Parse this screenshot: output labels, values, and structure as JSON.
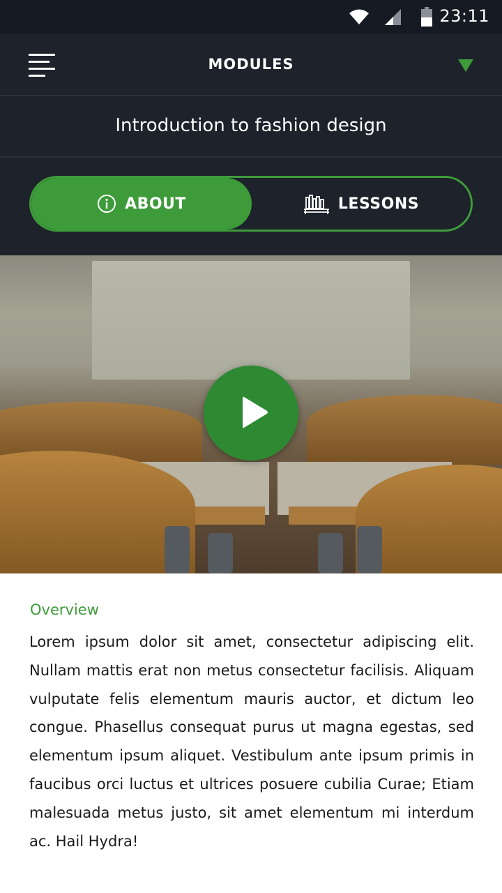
{
  "status_bar": {
    "time": "23:11",
    "icons": [
      "wifi-icon",
      "cell-signal-icon",
      "battery-icon"
    ]
  },
  "app_bar": {
    "title": "MODULES",
    "menu_icon": "menu-icon",
    "dropdown_icon": "triangle-down-icon"
  },
  "course": {
    "title": "Introduction to fashion design"
  },
  "tabs": [
    {
      "label": "ABOUT",
      "icon": "info-icon",
      "active": true
    },
    {
      "label": "LESSONS",
      "icon": "bookshelf-icon",
      "active": false
    }
  ],
  "video": {
    "play_icon": "play-icon"
  },
  "overview": {
    "label": "Overview",
    "text": "Lorem ipsum dolor sit amet, consectetur adipiscing elit. Nullam mattis erat non metus consectetur facili­sis. Aliquam vulputate felis elementum mauris auctor, et dictum leo congue. Phasellus consequat purus ut magna egestas, sed elementum ipsum ali­quet. Vestibulum ante ipsum primis in faucibus orci luctus et ultrices posuere cubilia Curae; Etiam male­suada metus justo, sit amet elementum mi interdum ac. Hail Hydra!"
  },
  "colors": {
    "accent": "#3e9b3a",
    "dark_bg": "#1d222b",
    "status_bg": "#161b23"
  }
}
